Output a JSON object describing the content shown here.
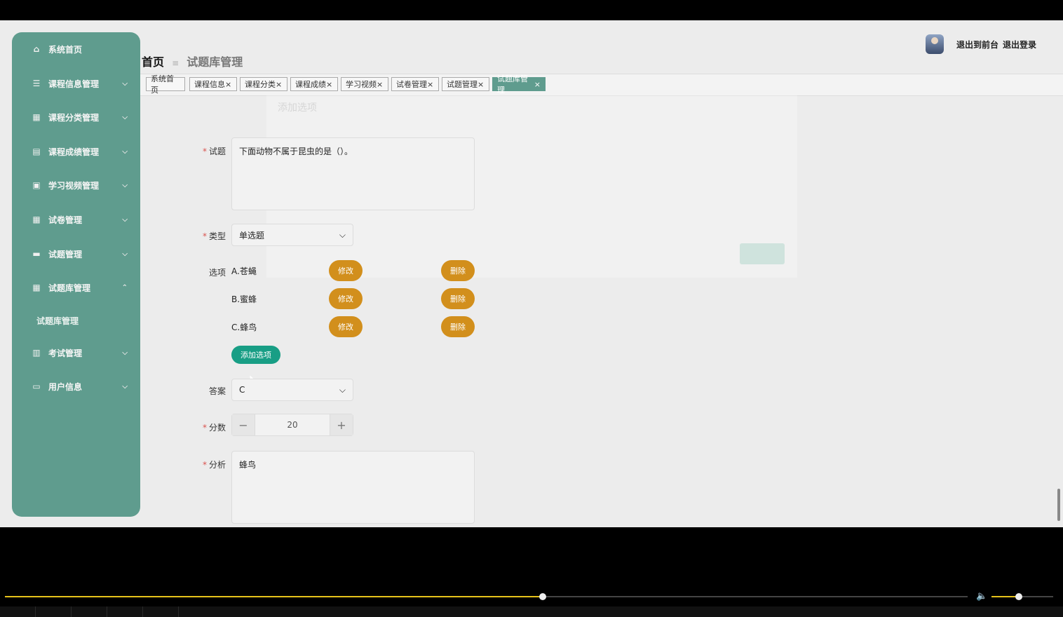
{
  "sidebar": {
    "items": [
      {
        "label": "系统首页",
        "icon": "home-icon",
        "glyph": "⌂",
        "chevron": ""
      },
      {
        "label": "课程信息管理",
        "icon": "list-icon",
        "glyph": "☰",
        "chevron": "⌵"
      },
      {
        "label": "课程分类管理",
        "icon": "grid-icon",
        "glyph": "▦",
        "chevron": "⌵"
      },
      {
        "label": "课程成绩管理",
        "icon": "chart-icon",
        "glyph": "▤",
        "chevron": "⌵"
      },
      {
        "label": "学习视频管理",
        "icon": "video-icon",
        "glyph": "▣",
        "chevron": "⌵"
      },
      {
        "label": "试卷管理",
        "icon": "grid-icon",
        "glyph": "▦",
        "chevron": "⌵"
      },
      {
        "label": "试题管理",
        "icon": "briefcase-icon",
        "glyph": "▬",
        "chevron": "⌵"
      },
      {
        "label": "试题库管理",
        "icon": "grid-icon",
        "glyph": "▦",
        "chevron": "⌃"
      },
      {
        "label": "考试管理",
        "icon": "clipboard-icon",
        "glyph": "▥",
        "chevron": "⌵"
      },
      {
        "label": "用户信息",
        "icon": "card-icon",
        "glyph": "▭",
        "chevron": "⌵"
      }
    ],
    "submenu_label": "试题库管理"
  },
  "header": {
    "home": "首页",
    "separator": "≡",
    "current": "试题库管理",
    "user_front": "退出到前台",
    "user_logout": "退出登录"
  },
  "tabs": [
    {
      "label": "系统首页",
      "close": ""
    },
    {
      "label": "课程信息",
      "close": "×"
    },
    {
      "label": "课程分类",
      "close": "×"
    },
    {
      "label": "课程成绩",
      "close": "×"
    },
    {
      "label": "学习视频",
      "close": "×"
    },
    {
      "label": "试卷管理",
      "close": "×"
    },
    {
      "label": "试题管理",
      "close": "×"
    },
    {
      "label": "试题库管理",
      "close": "×"
    }
  ],
  "form": {
    "question_label": "试题",
    "question_value": "下面动物不属于昆虫的是（）。",
    "type_label": "类型",
    "type_value": "单选题",
    "options_label": "选项",
    "options": [
      {
        "text": "A.苍蝇",
        "edit": "修改",
        "delete": "删除"
      },
      {
        "text": "B.蜜蜂",
        "edit": "修改",
        "delete": "删除"
      },
      {
        "text": "C.蜂鸟",
        "edit": "修改",
        "delete": "删除"
      }
    ],
    "add_option": "添加选项",
    "answer_label": "答案",
    "answer_value": "C",
    "score_label": "分数",
    "score_value": "20",
    "analysis_label": "分析",
    "analysis_value": "蜂鸟",
    "required_mark": "*"
  },
  "ghost_modal": {
    "title": "添加选项"
  },
  "player": {
    "progress": 0.56,
    "volume": 0.44
  }
}
